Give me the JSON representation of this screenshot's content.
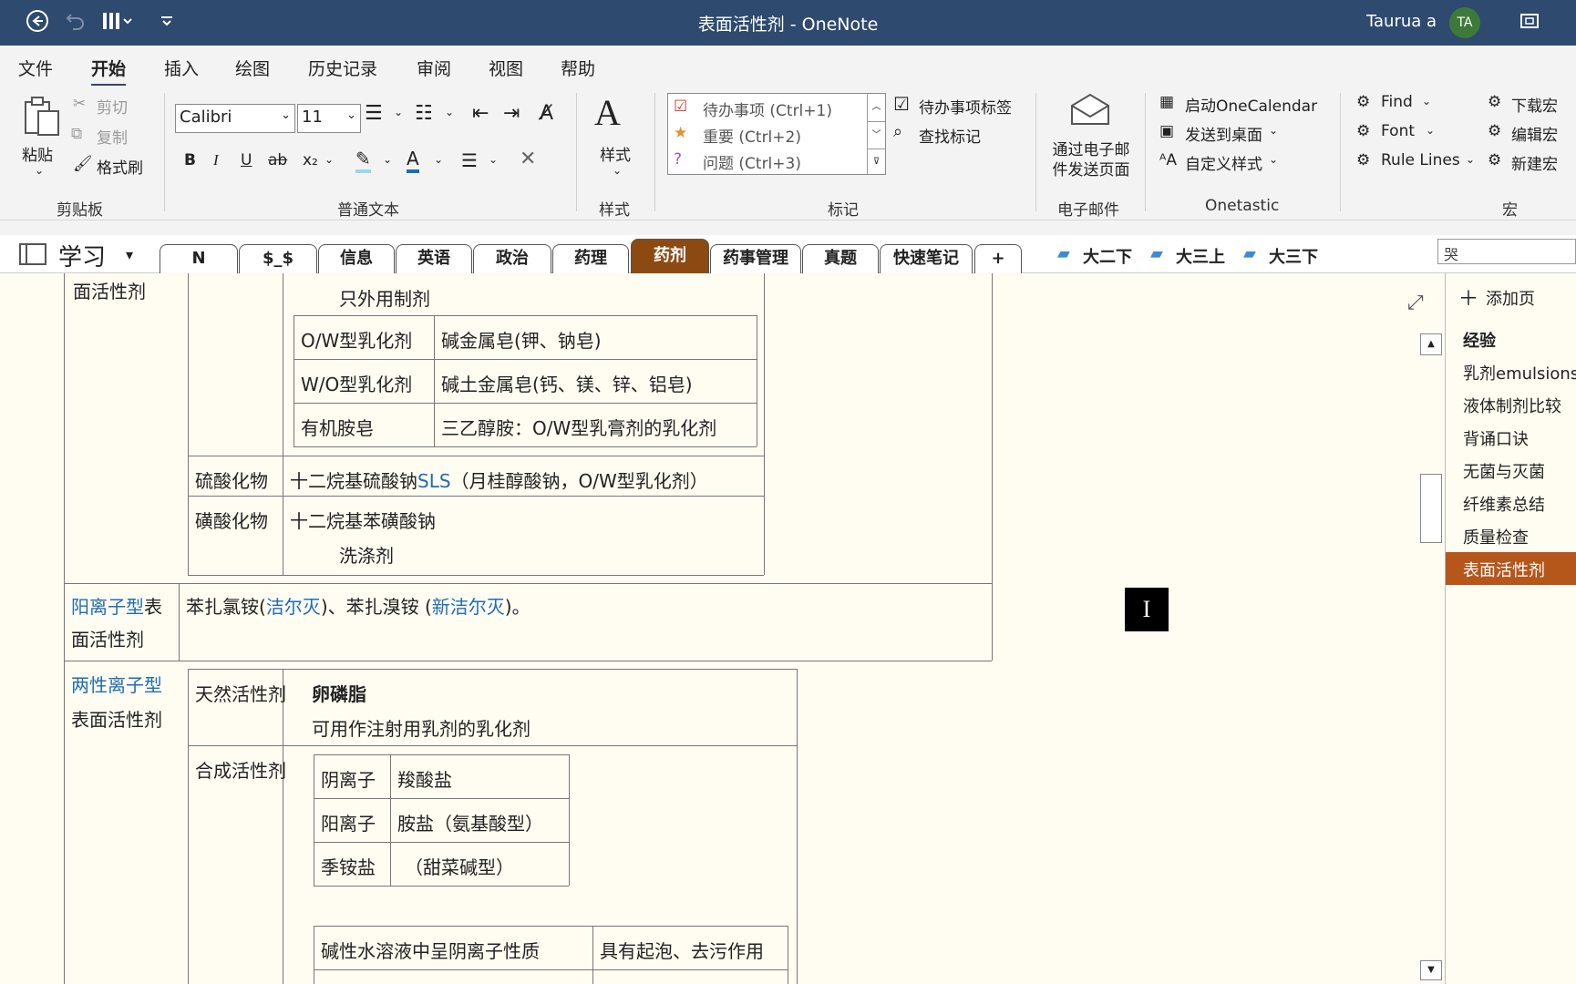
{
  "titlebar": {
    "title": "表面活性剂  -  OneNote",
    "user": "Taurua a",
    "avatar": "TA",
    "icons": [
      "back-icon",
      "undo-icon",
      "touch-mode-icon",
      "quick-access-dropdown-icon",
      "restore-window-icon"
    ]
  },
  "menu": [
    "文件",
    "开始",
    "插入",
    "绘图",
    "历史记录",
    "审阅",
    "视图",
    "帮助"
  ],
  "ribbon": {
    "clipboard": {
      "paste": "粘贴",
      "cut": "剪切",
      "copy": "复制",
      "format_painter": "格式刷",
      "label": "剪贴板"
    },
    "text": {
      "font": "Calibri",
      "size": "11",
      "label": "普通文本"
    },
    "styles": {
      "styles": "样式",
      "label": "样式"
    },
    "tags": {
      "items": [
        "待办事项 (Ctrl+1)",
        "重要 (Ctrl+2)",
        "问题 (Ctrl+3)"
      ],
      "todo_tag": "待办事项标签",
      "find_tags": "查找标记",
      "label": "标记"
    },
    "email": {
      "button": "通过电子邮件发送页面",
      "line1": "通过电子邮",
      "line2": "件发送页面",
      "label": "电子邮件"
    },
    "onetastic": {
      "calendar": "启动OneCalendar",
      "send_desktop": "发送到桌面",
      "custom_style": "自定义样式",
      "label": "Onetastic"
    },
    "macros": {
      "find": "Find",
      "font": "Font",
      "rule_lines": "Rule Lines",
      "download": "下载宏",
      "edit": "编辑宏",
      "new": "新建宏",
      "label": "宏"
    }
  },
  "notebook": {
    "name": "学习",
    "sections": [
      "N",
      "$_$",
      "信息",
      "英语",
      "政治",
      "药理",
      "药剂",
      "药事管理",
      "真题",
      "快速笔记",
      "+"
    ],
    "active_section": "药剂",
    "section_groups": [
      "大二下",
      "大三上",
      "大三下"
    ],
    "search_value": "哭"
  },
  "pages": {
    "add_page": "添加页",
    "items": [
      "经验",
      "乳剂emulsions",
      "液体制剂比较",
      "背诵口诀",
      "无菌与灭菌",
      "纤维素总结",
      "质量检查",
      "表面活性剂"
    ],
    "active": "表面活性剂"
  },
  "content": {
    "anionic_left_tail": "面活性剂",
    "external_use": "只外用制剂",
    "soaps": [
      [
        "O/W型乳化剂",
        "碱金属皂(钾、钠皂)"
      ],
      [
        "W/O型乳化剂",
        "碱土金属皂(钙、镁、锌、铝皂)"
      ],
      [
        "有机胺皂",
        "三乙醇胺：O/W型乳膏剂的乳化剂"
      ]
    ],
    "sulfates": {
      "label": "硫酸化物",
      "text_pre": "十二烷基硫酸钠",
      "text_blue": "SLS",
      "text_post": "（月桂醇酸钠，O/W型乳化剂）"
    },
    "sulfonates": {
      "label": "磺酸化物",
      "text": "十二烷基苯磺酸钠",
      "sub": "洗涤剂"
    },
    "cationic": {
      "label_blue": "阳离子型",
      "label_rest": "表",
      "label_line2": "面活性剂",
      "t1": "苯扎氯铵(",
      "t1_blue": "洁尔灭",
      "t2": ")、苯扎溴铵 (",
      "t2_blue": "新洁尔灭",
      "t3": ")。"
    },
    "amphoteric": {
      "label_blue": "两性离子型",
      "label_line2": "表面活性剂",
      "natural": "天然活性剂",
      "natural_title": "卵磷脂",
      "natural_desc": "可用作注射用乳剂的乳化剂",
      "synthetic": "合成活性剂",
      "synth_rows": [
        [
          "阴离子",
          "羧酸盐"
        ],
        [
          "阳离子",
          "胺盐（氨基酸型）"
        ],
        [
          "季铵盐",
          "（甜菜碱型）"
        ]
      ],
      "property_left": "碱性水溶液中呈阴离子性质",
      "property_right": "具有起泡、去污作用"
    }
  }
}
